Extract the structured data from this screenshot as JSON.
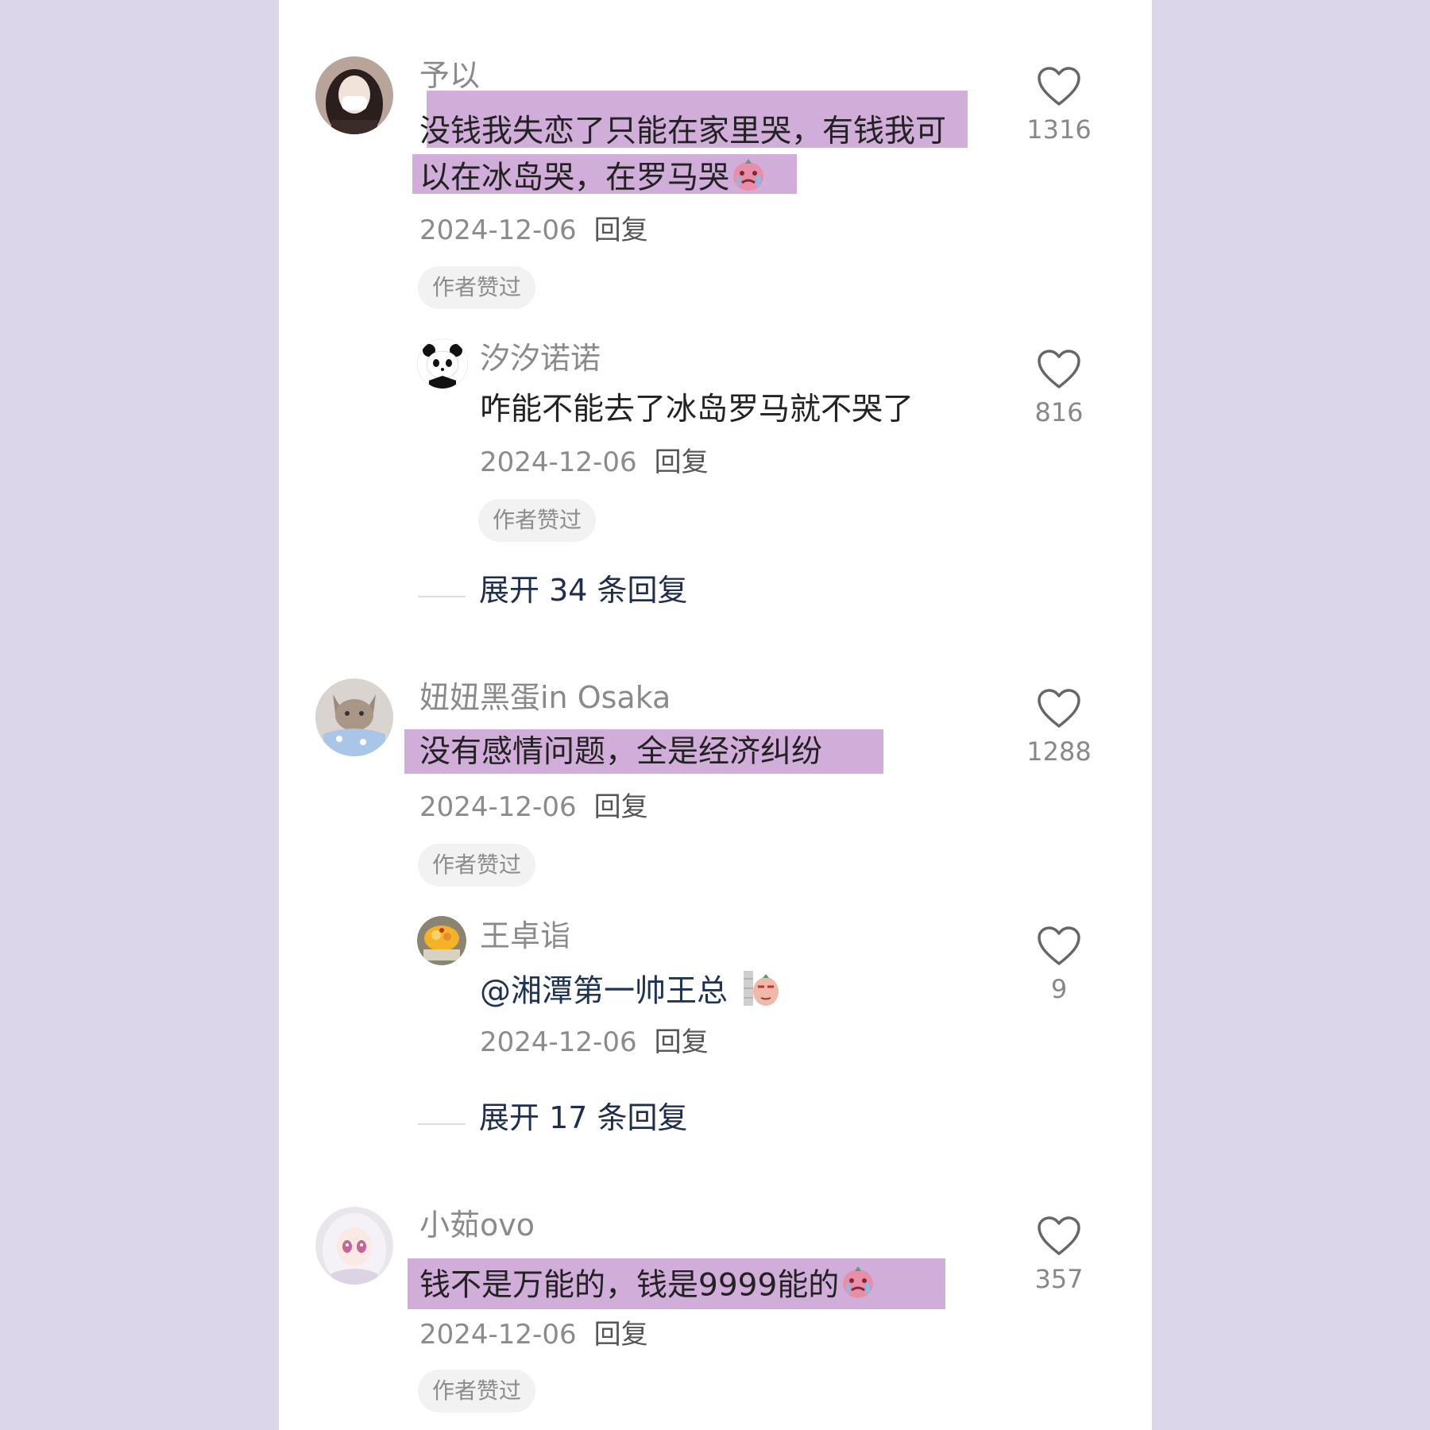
{
  "comments": [
    {
      "username": "予以",
      "text_line1": "没钱我失恋了只能在家里哭，有钱我可",
      "text_line2": "以在冰岛哭，在罗马哭",
      "date": "2024-12-06",
      "reply": "回复",
      "badge": "作者赞过",
      "likes": "1316",
      "sub": {
        "username": "汐汐诺诺",
        "text": "咋能不能去了冰岛罗马就不哭了",
        "date": "2024-12-06",
        "reply": "回复",
        "badge": "作者赞过",
        "likes": "816"
      },
      "expand": "展开 34 条回复"
    },
    {
      "username": "妞妞黑蛋in Osaka",
      "text": "没有感情问题，全是经济纠纷",
      "date": "2024-12-06",
      "reply": "回复",
      "badge": "作者赞过",
      "likes": "1288",
      "sub": {
        "username": "王卓诣",
        "mention": "@湘潭第一帅王总",
        "date": "2024-12-06",
        "reply": "回复",
        "likes": "9"
      },
      "expand": "展开 17 条回复"
    },
    {
      "username": "小茹ovo",
      "text": "钱不是万能的，钱是9999能的",
      "date": "2024-12-06",
      "reply": "回复",
      "badge": "作者赞过",
      "likes": "357"
    }
  ],
  "colors": {
    "background": "#dcd6ea",
    "highlight": "#d1aed9",
    "link": "#1f2d4e"
  }
}
